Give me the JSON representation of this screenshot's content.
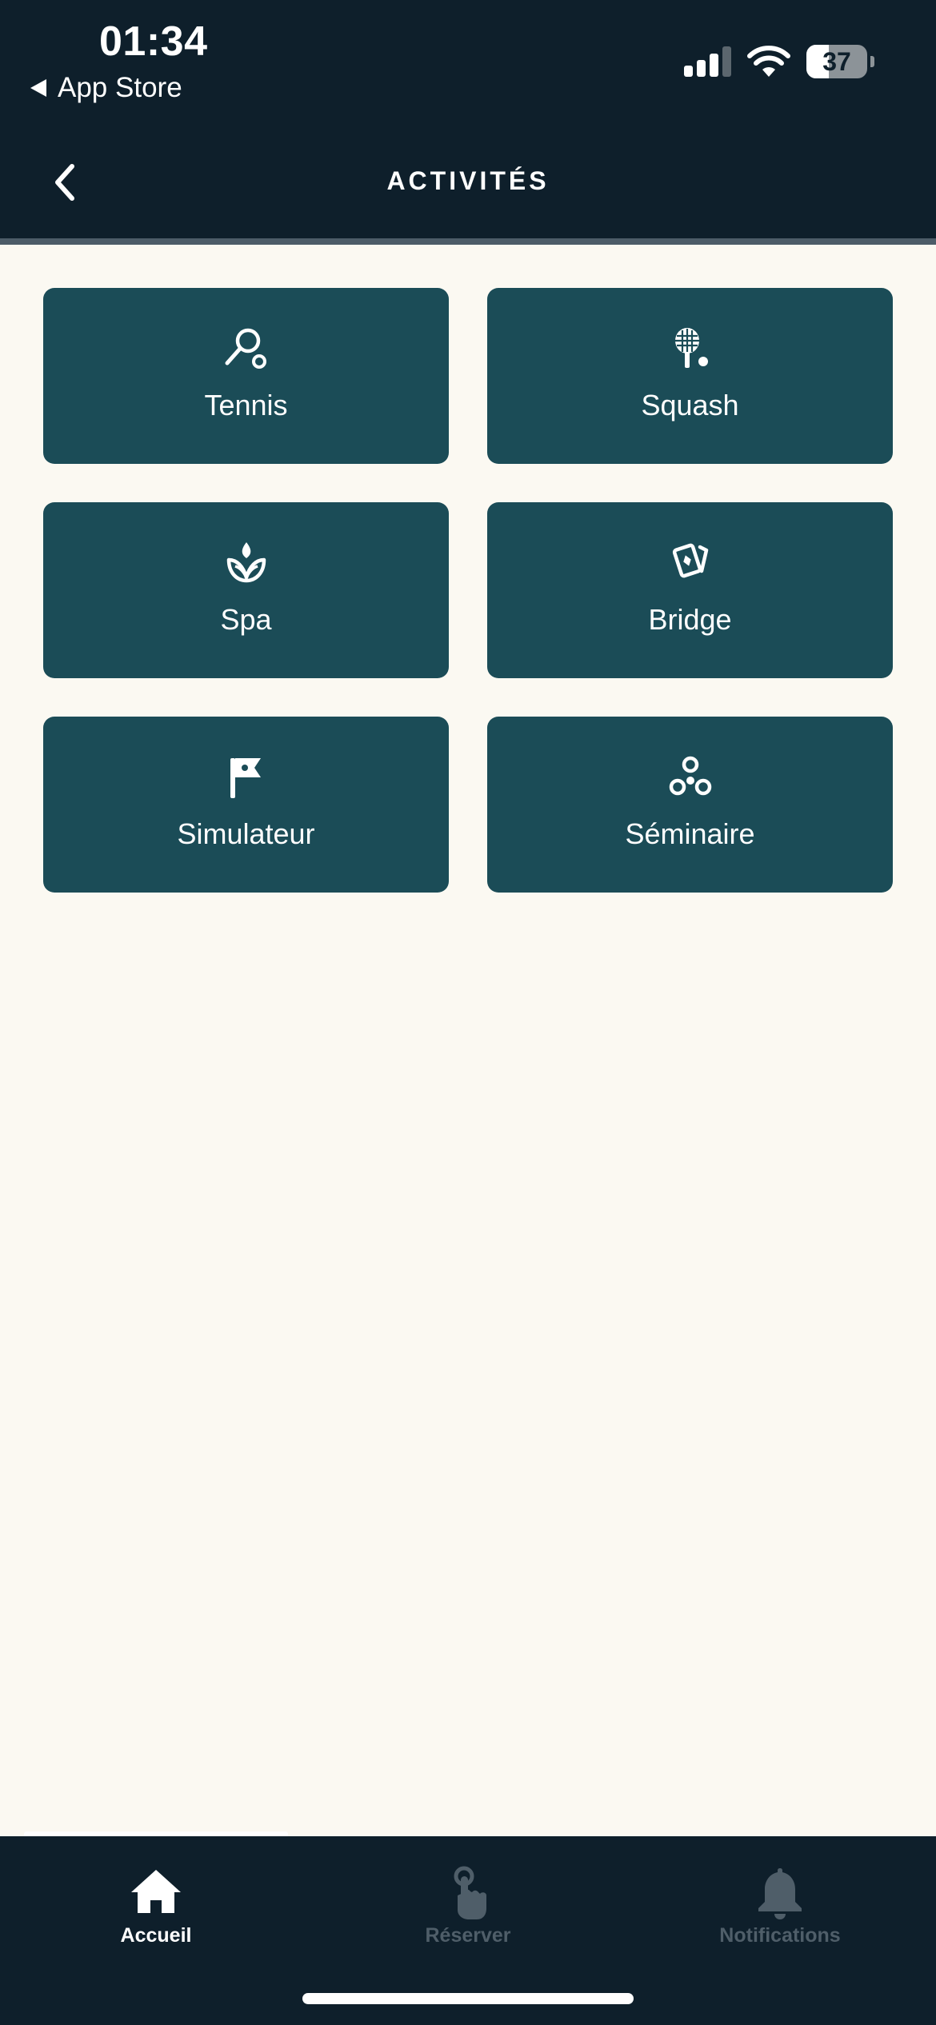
{
  "status_bar": {
    "time": "01:34",
    "back_app": "App Store",
    "battery": "37",
    "battery_level": 0.37
  },
  "nav": {
    "title": "ACTIVITÉS"
  },
  "activities": [
    {
      "label": "Tennis",
      "icon": "tennis-racket-icon"
    },
    {
      "label": "Squash",
      "icon": "squash-racket-icon"
    },
    {
      "label": "Spa",
      "icon": "lotus-icon"
    },
    {
      "label": "Bridge",
      "icon": "playing-cards-icon"
    },
    {
      "label": "Simulateur",
      "icon": "golf-flag-icon"
    },
    {
      "label": "Séminaire",
      "icon": "group-icon"
    }
  ],
  "tab_bar": {
    "items": [
      {
        "label": "Accueil",
        "icon": "home-icon",
        "active": true
      },
      {
        "label": "Réserver",
        "icon": "tap-hand-icon",
        "active": false
      },
      {
        "label": "Notifications",
        "icon": "bell-icon",
        "active": false
      }
    ]
  },
  "colors": {
    "header_bg": "#0e1f2b",
    "page_bg": "#fbf9f2",
    "tile_bg": "#1b4c57",
    "tab_active": "#ffffff",
    "tab_inactive": "#4f5e69"
  }
}
